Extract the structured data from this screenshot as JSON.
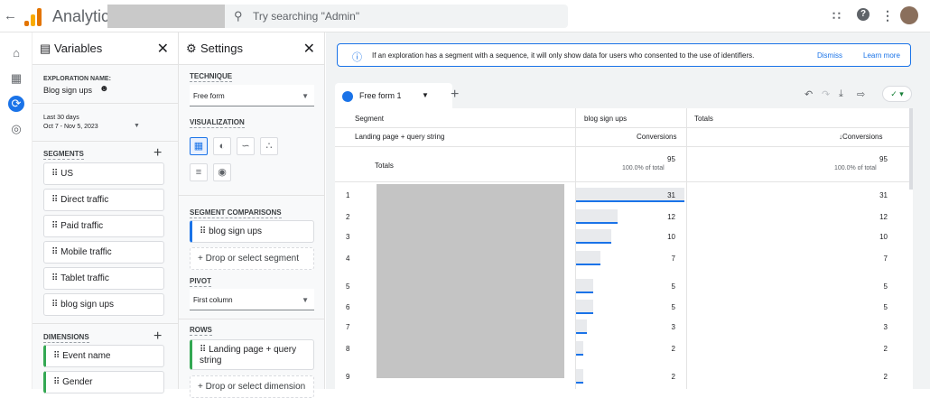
{
  "topbar": {
    "back": "←",
    "title": "Analytics",
    "search_placeholder": "Try searching \"Admin\"",
    "apps_icon": "apps-icon",
    "help_icon": "help-icon",
    "more_icon": "more-icon"
  },
  "nav": [
    "home-icon",
    "reports-icon",
    "explore-icon",
    "advertising-icon"
  ],
  "variables": {
    "title": "Variables",
    "exploration_label": "EXPLORATION NAME:",
    "exploration_name": "Blog sign ups",
    "date_range_label": "Last 30 days",
    "date_range": "Oct 7 - Nov 5, 2023",
    "segments_label": "SEGMENTS",
    "segments": [
      "US",
      "Direct traffic",
      "Paid traffic",
      "Mobile traffic",
      "Tablet traffic",
      "blog sign ups"
    ],
    "dimensions_label": "DIMENSIONS",
    "dimensions": [
      "Event name",
      "Gender"
    ]
  },
  "settings": {
    "title": "Settings",
    "technique_label": "TECHNIQUE",
    "technique": "Free form",
    "visualization_label": "VISUALIZATION",
    "segment_comparisons_label": "SEGMENT COMPARISONS",
    "segment_comparison": "blog sign ups",
    "drop_segment": "+ Drop or select segment",
    "pivot_label": "PIVOT",
    "pivot": "First column",
    "rows_label": "ROWS",
    "row_dim": "Landing page + query string",
    "drop_dimension": "+ Drop or select dimension"
  },
  "notice": {
    "text": "If an exploration has a segment with a sequence, it will only show data for users who consented to the use of identifiers.",
    "dismiss": "Dismiss",
    "learn_more": "Learn more"
  },
  "tab": {
    "label": "Free form 1"
  },
  "table": {
    "header_segment": "Segment",
    "header_segment_col": "blog sign ups",
    "header_totals": "Totals",
    "dim_header": "Landing page + query string",
    "metric_header": "Conversions",
    "metric_header_totals": "↓Conversions",
    "totals_label": "Totals",
    "totals_value": "95",
    "totals_pct": "100.0% of total",
    "totals_value2": "95",
    "totals_pct2": "100.0% of total",
    "rows": [
      {
        "n": "1",
        "v": "31",
        "t": "31",
        "frac": 1.0
      },
      {
        "n": "2",
        "v": "12",
        "t": "12",
        "frac": 0.387
      },
      {
        "n": "3",
        "v": "10",
        "t": "10",
        "frac": 0.323
      },
      {
        "n": "4",
        "v": "7",
        "t": "7",
        "frac": 0.226
      },
      {
        "n": "5",
        "v": "5",
        "t": "5",
        "frac": 0.161
      },
      {
        "n": "6",
        "v": "5",
        "t": "5",
        "frac": 0.161
      },
      {
        "n": "7",
        "v": "3",
        "t": "3",
        "frac": 0.097
      },
      {
        "n": "8",
        "v": "2",
        "t": "2",
        "frac": 0.065
      },
      {
        "n": "9",
        "v": "2",
        "t": "2",
        "frac": 0.065
      }
    ]
  }
}
